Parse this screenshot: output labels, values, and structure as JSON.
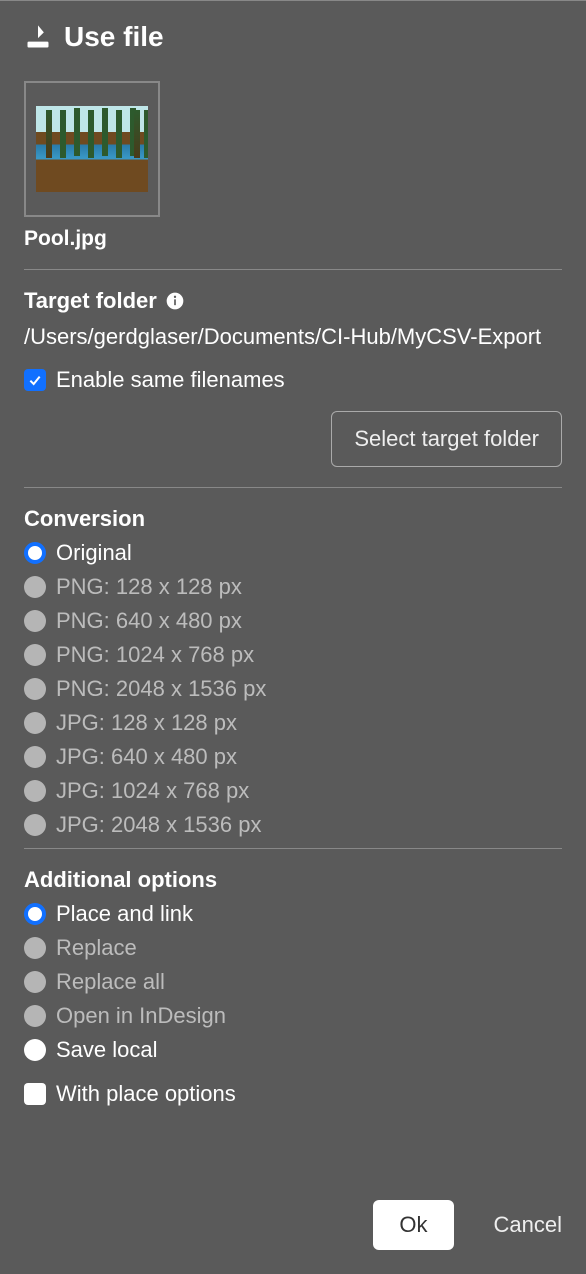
{
  "header": {
    "title": "Use file"
  },
  "file": {
    "name": "Pool.jpg"
  },
  "target": {
    "label": "Target folder",
    "path": "/Users/gerdglaser/Documents/CI-Hub/MyCSV-Export",
    "enable_same_filenames_label": "Enable same filenames",
    "enable_same_filenames_checked": true,
    "select_button": "Select target folder"
  },
  "conversion": {
    "title": "Conversion",
    "options": [
      {
        "label": "Original",
        "selected": true,
        "enabled": true
      },
      {
        "label": "PNG: 128 x 128 px",
        "selected": false,
        "enabled": false
      },
      {
        "label": "PNG: 640 x 480 px",
        "selected": false,
        "enabled": false
      },
      {
        "label": "PNG: 1024 x 768 px",
        "selected": false,
        "enabled": false
      },
      {
        "label": "PNG: 2048 x 1536 px",
        "selected": false,
        "enabled": false
      },
      {
        "label": "JPG: 128 x 128 px",
        "selected": false,
        "enabled": false
      },
      {
        "label": "JPG: 640 x 480 px",
        "selected": false,
        "enabled": false
      },
      {
        "label": "JPG: 1024 x 768 px",
        "selected": false,
        "enabled": false
      },
      {
        "label": "JPG: 2048 x 1536 px",
        "selected": false,
        "enabled": false
      }
    ]
  },
  "additional": {
    "title": "Additional options",
    "options": [
      {
        "label": "Place and link",
        "selected": true,
        "enabled": true
      },
      {
        "label": "Replace",
        "selected": false,
        "enabled": false
      },
      {
        "label": "Replace all",
        "selected": false,
        "enabled": false
      },
      {
        "label": "Open in InDesign",
        "selected": false,
        "enabled": false
      },
      {
        "label": "Save local",
        "selected": false,
        "enabled": true
      }
    ],
    "with_place_options_label": "With place options",
    "with_place_options_checked": false
  },
  "footer": {
    "ok": "Ok",
    "cancel": "Cancel"
  }
}
